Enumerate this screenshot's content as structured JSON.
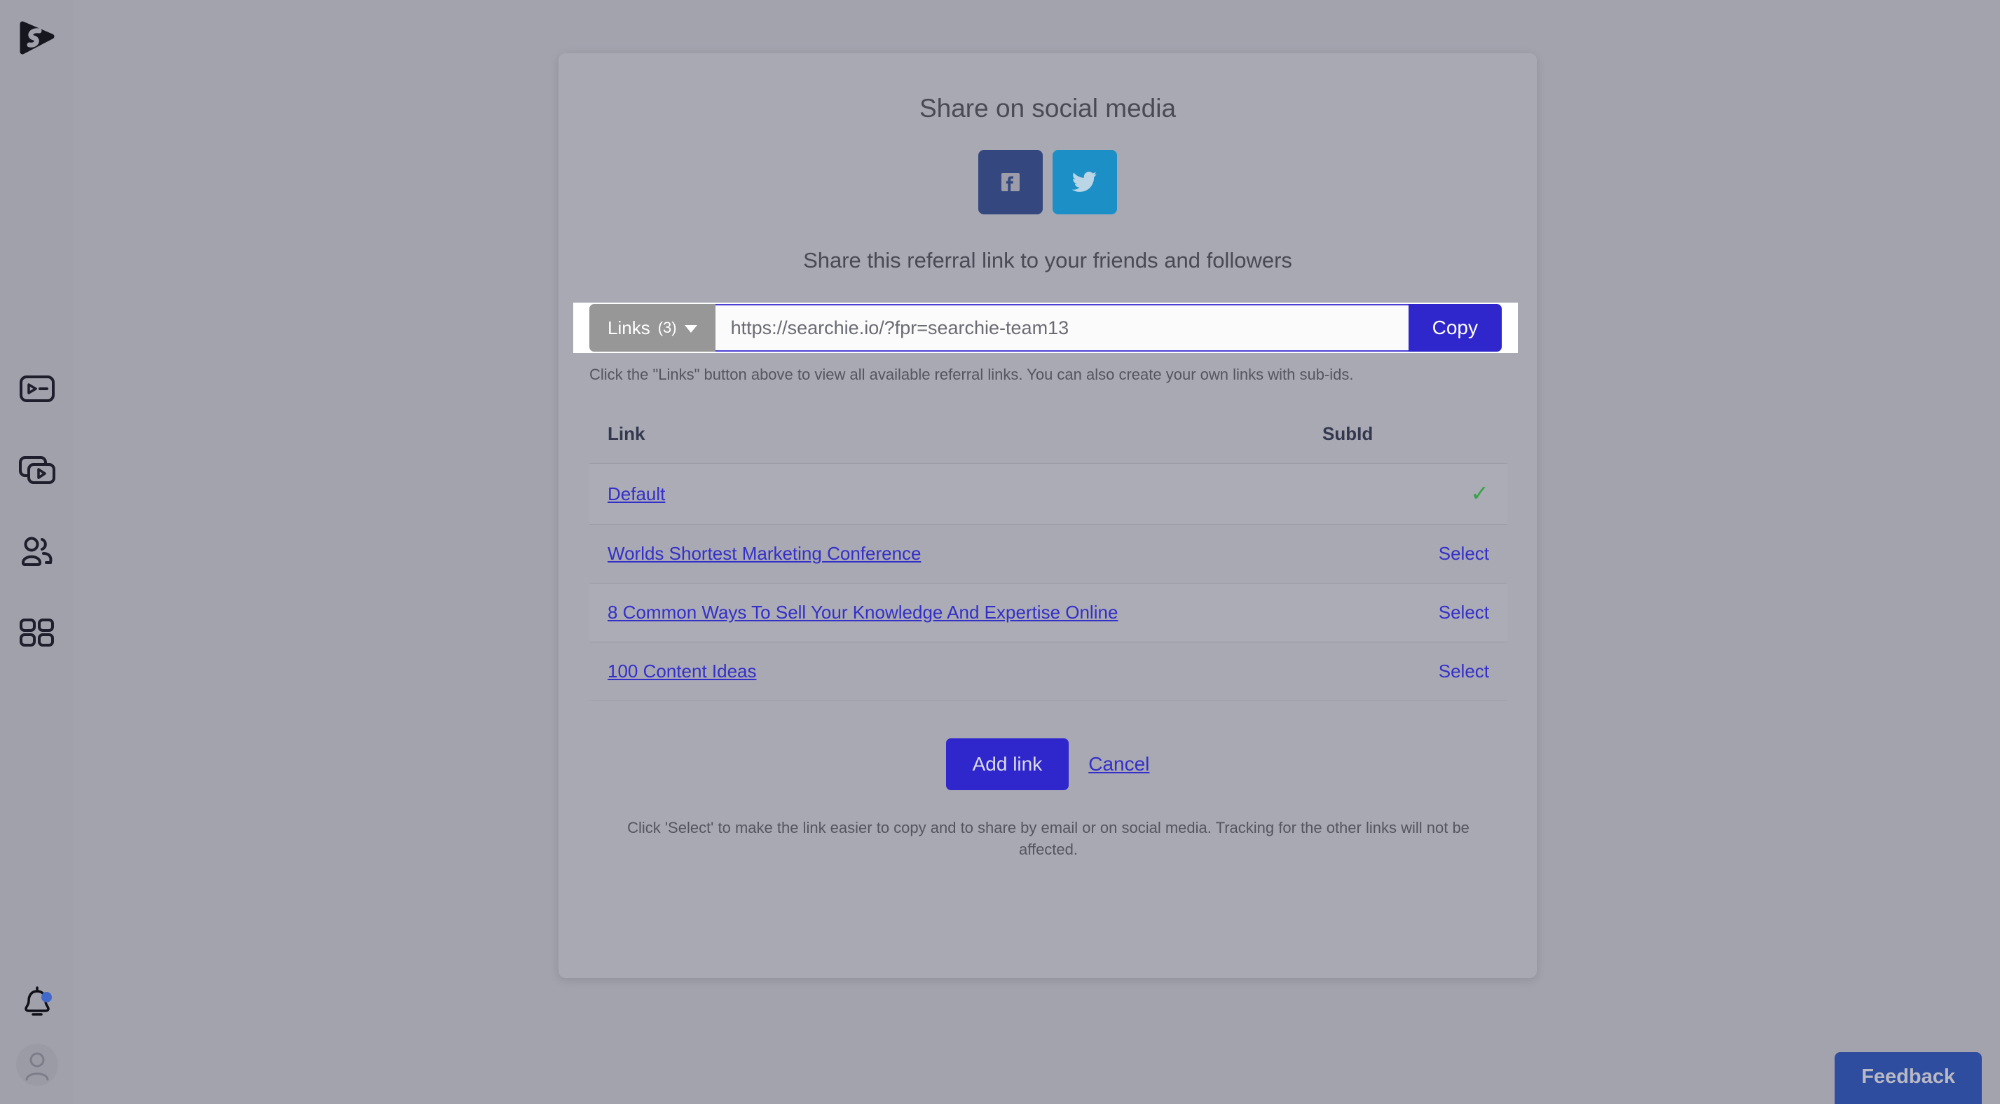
{
  "sidebar": {
    "logo": "searchie-logo",
    "nav_items": [
      {
        "name": "media-player-icon",
        "label": "Media"
      },
      {
        "name": "video-library-icon",
        "label": "Library"
      },
      {
        "name": "audiences-icon",
        "label": "Audiences"
      },
      {
        "name": "apps-grid-icon",
        "label": "Apps"
      }
    ],
    "notifications": {
      "icon": "bell-icon",
      "has_unread": true
    },
    "account": {
      "icon": "user-avatar-icon"
    }
  },
  "modal": {
    "title": "Share on social media",
    "social_buttons": [
      {
        "name": "facebook-share-button",
        "platform": "facebook",
        "color": "#34477e"
      },
      {
        "name": "twitter-share-button",
        "platform": "twitter",
        "color": "#1b8fc6"
      }
    ],
    "referral_heading": "Share this referral link to your friends and followers",
    "links_dropdown": {
      "label": "Links",
      "count": "(3)"
    },
    "referral_url": "https://searchie.io/?fpr=searchie-team13",
    "referral_placeholder": "https://searchie.io/?fpr=searchie-team13",
    "copy_label": "Copy",
    "helper_text": "Click the \"Links\" button above to view all available referral links. You can also create your own links with sub-ids.",
    "table": {
      "columns": [
        "Link",
        "SubId"
      ],
      "rows": [
        {
          "link": "Default",
          "action": "selected",
          "action_label": "✓"
        },
        {
          "link": "Worlds Shortest Marketing Conference",
          "action": "select",
          "action_label": "Select"
        },
        {
          "link": "8 Common Ways To Sell Your Knowledge And Expertise Online",
          "action": "select",
          "action_label": "Select"
        },
        {
          "link": "100 Content Ideas",
          "action": "select",
          "action_label": "Select"
        }
      ]
    },
    "add_link_label": "Add link",
    "cancel_label": "Cancel",
    "footer_note": "Click 'Select' to make the link easier to copy and to share by email or on social media. Tracking for the other links will not be affected."
  },
  "feedback": {
    "label": "Feedback"
  },
  "colors": {
    "page_bg": "#a3a3ae",
    "modal_bg": "#a9a9b4",
    "accent": "#2f27cc",
    "link": "#332fc8",
    "check_green": "#39a349",
    "feedback_bg": "#2f4d9e"
  }
}
